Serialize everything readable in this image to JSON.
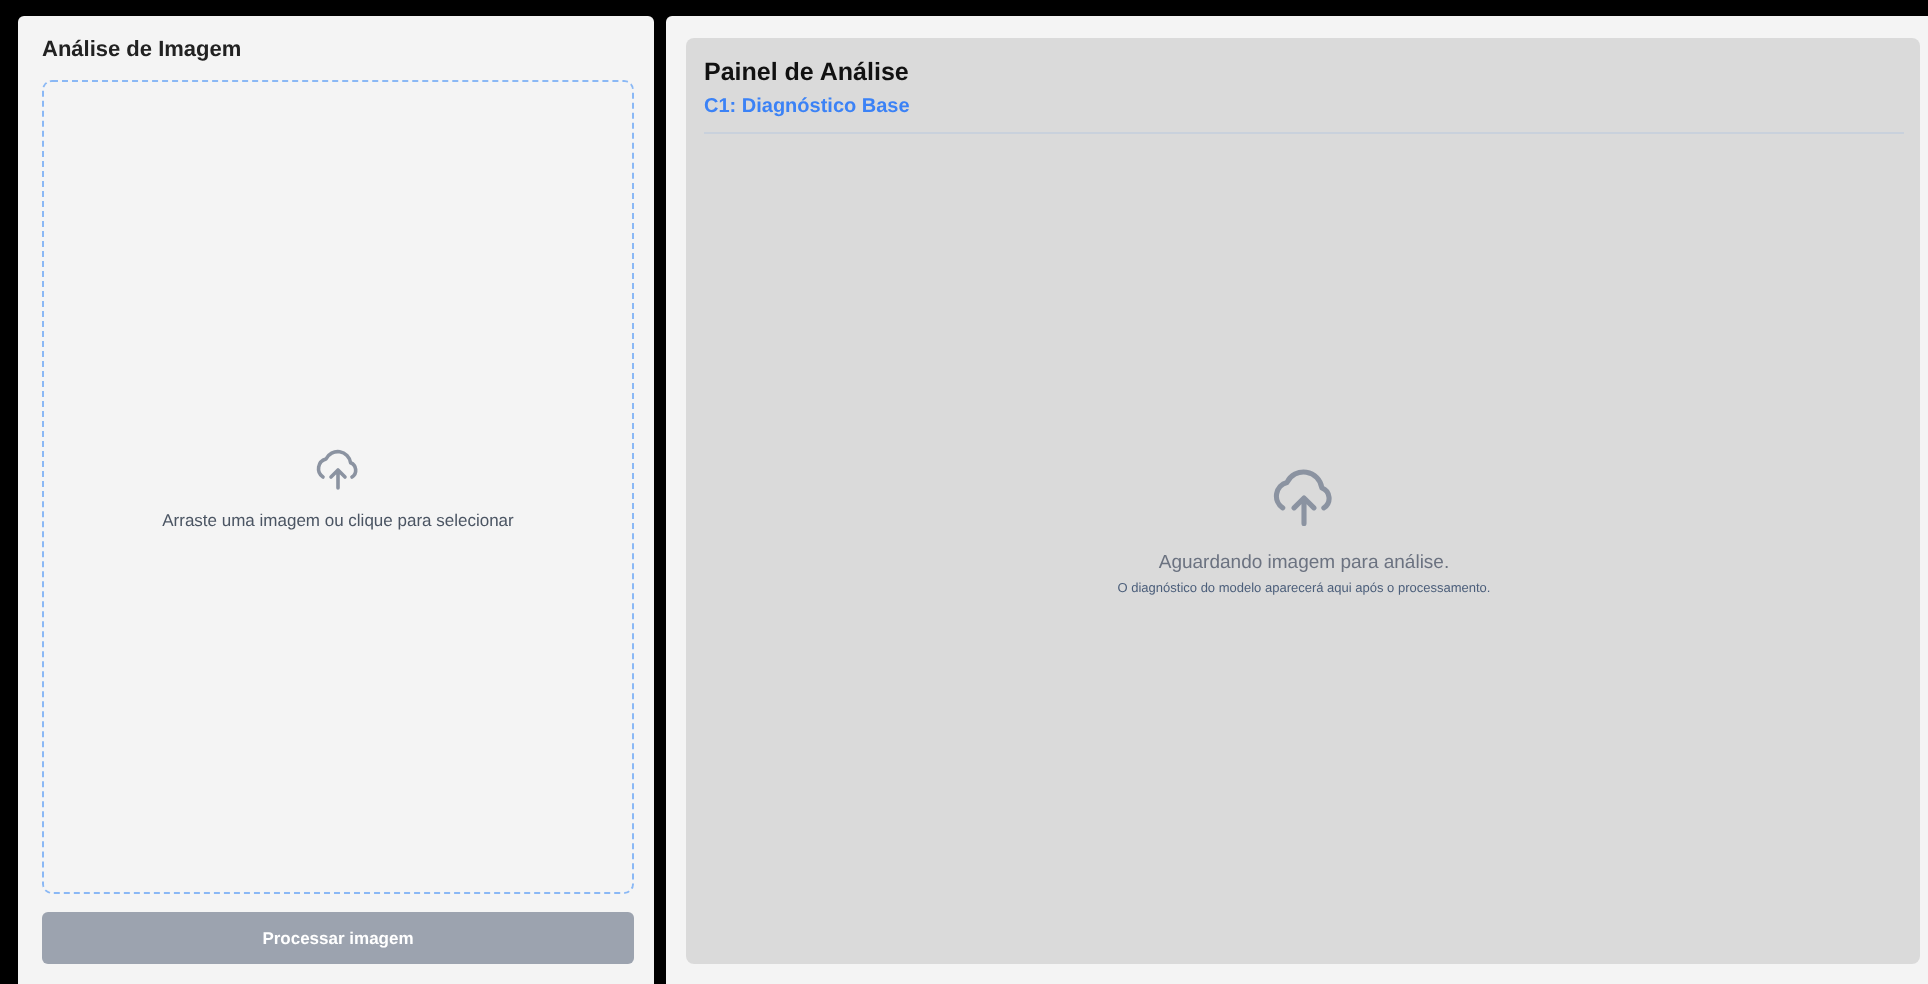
{
  "upload_panel": {
    "title": "Análise de Imagem",
    "dropzone": {
      "hint": "Arraste uma imagem ou clique para selecionar"
    },
    "button": {
      "label": "Processar imagem",
      "disabled": true
    }
  },
  "analysis_panel": {
    "title": "Painel de Análise",
    "subtitle": "C1: Diagnóstico Base",
    "empty_state": {
      "message": "Aguardando imagem para análise.",
      "detail": "O diagnóstico do modelo aparecerá aqui após o processamento."
    }
  }
}
